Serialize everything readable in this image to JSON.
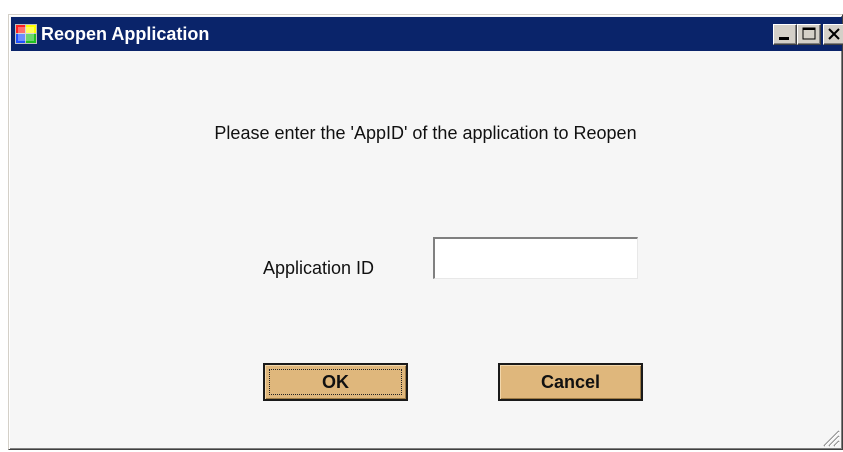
{
  "window": {
    "title": "Reopen Application",
    "icon": "app-window-icon",
    "controls": [
      "minimize-icon",
      "maximize-icon",
      "close-icon"
    ]
  },
  "dialog": {
    "prompt": "Please enter the 'AppID' of the application to Reopen",
    "field_label": "Application ID",
    "field_value": "",
    "ok_label": "OK",
    "cancel_label": "Cancel"
  },
  "colors": {
    "titlebar": "#0a246a",
    "dialog_background": "#f6f6f6",
    "button_face": "#dfb77c"
  }
}
